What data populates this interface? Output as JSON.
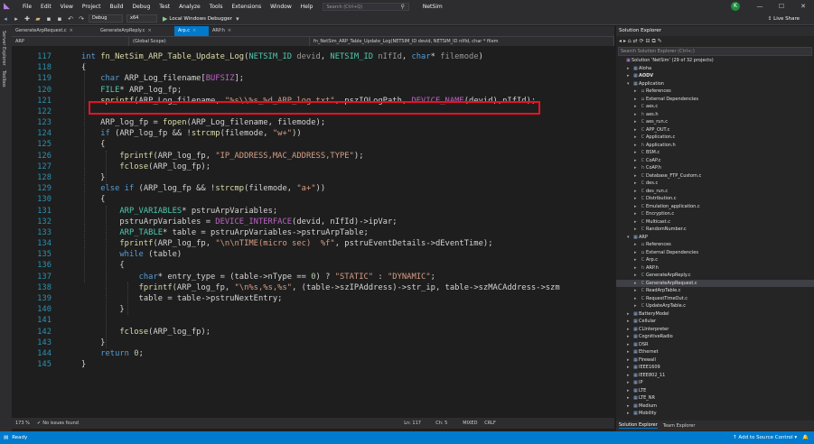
{
  "menubar": {
    "items": [
      "File",
      "Edit",
      "View",
      "Project",
      "Build",
      "Debug",
      "Test",
      "Analyze",
      "Tools",
      "Extensions",
      "Window",
      "Help"
    ],
    "search_placeholder": "Search (Ctrl+Q)",
    "app_title": "NetSim",
    "avatar_letter": "K"
  },
  "toolbar": {
    "config": "Debug",
    "platform": "x64",
    "run_label": "Local Windows Debugger",
    "live_share": "Live Share"
  },
  "left_strip": {
    "server_explorer": "Server Explorer",
    "toolbox": "Toolbox"
  },
  "tabs": [
    {
      "label": "GenerateArpRequest.c",
      "close": "×"
    },
    {
      "label": "GenerateArpReply.c",
      "close": "×"
    },
    {
      "label": "Arp.c",
      "close": "×"
    },
    {
      "label": "ARP.h",
      "close": "×"
    }
  ],
  "scope": {
    "project": "ARP",
    "scope": "(Global Scope)",
    "function": "fn_NetSim_ARP_Table_Update_Log(NETSIM_ID devid, NETSIM_ID nIfId, char * filem"
  },
  "code": {
    "line_numbers": [
      "117",
      "118",
      "119",
      "120",
      "121",
      "122",
      "123",
      "124",
      "125",
      "126",
      "127",
      "128",
      "129",
      "130",
      "131",
      "132",
      "133",
      "134",
      "135",
      "136",
      "137",
      "138",
      "139",
      "140",
      "141",
      "142",
      "143",
      "144",
      "145"
    ],
    "lines": [
      [
        [
          "kw",
          "int "
        ],
        [
          "fn",
          "fn_NetSim_ARP_Table_Update_Log"
        ],
        [
          "",
          "("
        ],
        [
          "ty",
          "NETSIM_ID"
        ],
        [
          "pm",
          " devid"
        ],
        [
          "",
          ", "
        ],
        [
          "ty",
          "NETSIM_ID"
        ],
        [
          "pm",
          " nIfId"
        ],
        [
          "",
          ", "
        ],
        [
          "kw",
          "char"
        ],
        [
          "",
          "* "
        ],
        [
          "pm",
          "filemode"
        ],
        [
          "",
          ")"
        ]
      ],
      [
        [
          "",
          "{"
        ]
      ],
      [
        [
          "",
          "    "
        ],
        [
          "kw",
          "char"
        ],
        [
          "",
          ""
        ],
        [
          "",
          " ARP_Log_filename["
        ],
        [
          "mc",
          "BUFSIZ"
        ],
        [
          "",
          "];"
        ]
      ],
      [
        [
          "",
          "    "
        ],
        [
          "ty",
          "FILE"
        ],
        [
          "",
          "* ARP_log_fp;"
        ]
      ],
      [
        [
          "",
          "    "
        ],
        [
          "fn",
          "sprintf"
        ],
        [
          "",
          "(ARP_Log_filename, "
        ],
        [
          "st",
          "\"%s\\\\%s_%d_ARP_log.txt\""
        ],
        [
          "",
          ", pszIOLogPath, "
        ],
        [
          "mc",
          "DEVICE_NAME"
        ],
        [
          "",
          "(devid),nIfId);"
        ]
      ],
      [
        [
          "",
          ""
        ]
      ],
      [
        [
          "",
          "    ARP_log_fp = "
        ],
        [
          "fn",
          "fopen"
        ],
        [
          "",
          "(ARP_Log_filename, filemode);"
        ]
      ],
      [
        [
          "",
          "    "
        ],
        [
          "kw",
          "if"
        ],
        [
          "",
          " (ARP_log_fp && !"
        ],
        [
          "fn",
          "strcmp"
        ],
        [
          "",
          "(filemode, "
        ],
        [
          "st",
          "\"w+\""
        ],
        [
          "",
          "))"
        ]
      ],
      [
        [
          "",
          "    {"
        ]
      ],
      [
        [
          "",
          "        "
        ],
        [
          "fn",
          "fprintf"
        ],
        [
          "",
          "(ARP_log_fp, "
        ],
        [
          "st",
          "\"IP_ADDRESS,MAC_ADDRESS,TYPE\""
        ],
        [
          "",
          ");"
        ]
      ],
      [
        [
          "",
          "        "
        ],
        [
          "fn",
          "fclose"
        ],
        [
          "",
          "(ARP_log_fp);"
        ]
      ],
      [
        [
          "",
          "    }"
        ]
      ],
      [
        [
          "",
          "    "
        ],
        [
          "kw",
          "else if"
        ],
        [
          "",
          " (ARP_log_fp && !"
        ],
        [
          "fn",
          "strcmp"
        ],
        [
          "",
          "(filemode, "
        ],
        [
          "st",
          "\"a+\""
        ],
        [
          "",
          "))"
        ]
      ],
      [
        [
          "",
          "    {"
        ]
      ],
      [
        [
          "",
          "        "
        ],
        [
          "ty",
          "ARP_VARIABLES"
        ],
        [
          "",
          "* pstruArpVariables;"
        ]
      ],
      [
        [
          "",
          "        pstruArpVariables = "
        ],
        [
          "mc",
          "DEVICE_INTERFACE"
        ],
        [
          "",
          "(devid, nIfId)->ipVar;"
        ]
      ],
      [
        [
          "",
          "        "
        ],
        [
          "ty",
          "ARP_TABLE"
        ],
        [
          "",
          "* table = pstruArpVariables->pstruArpTable;"
        ]
      ],
      [
        [
          "",
          "        "
        ],
        [
          "fn",
          "fprintf"
        ],
        [
          "",
          "(ARP_log_fp, "
        ],
        [
          "st",
          "\"\\n\\nTIME(micro sec)  %f\""
        ],
        [
          "",
          ", pstruEventDetails->dEventTime);"
        ]
      ],
      [
        [
          "",
          "        "
        ],
        [
          "kw",
          "while"
        ],
        [
          "",
          " (table)"
        ]
      ],
      [
        [
          "",
          "        {"
        ]
      ],
      [
        [
          "",
          "            "
        ],
        [
          "kw",
          "char"
        ],
        [
          "",
          "* entry_type = (table->nType == "
        ],
        [
          "nm",
          "0"
        ],
        [
          "",
          ") ? "
        ],
        [
          "st",
          "\"STATIC\""
        ],
        [
          "",
          " : "
        ],
        [
          "st",
          "\"DYNAMIC\""
        ],
        [
          "",
          ";"
        ]
      ],
      [
        [
          "",
          "            "
        ],
        [
          "fn",
          "fprintf"
        ],
        [
          "",
          "(ARP_log_fp, "
        ],
        [
          "st",
          "\"\\n%s,%s,%s\""
        ],
        [
          "",
          ", (table->szIPAddress)->str_ip, table->szMACAddress->szm"
        ]
      ],
      [
        [
          "",
          "            table = table->pstruNextEntry;"
        ]
      ],
      [
        [
          "",
          "        }"
        ]
      ],
      [
        [
          "",
          ""
        ]
      ],
      [
        [
          "",
          "        "
        ],
        [
          "fn",
          "fclose"
        ],
        [
          "",
          "(ARP_log_fp);"
        ]
      ],
      [
        [
          "",
          "    }"
        ]
      ],
      [
        [
          "",
          "    "
        ],
        [
          "kw",
          "return"
        ],
        [
          "",
          " "
        ],
        [
          "nm",
          "0"
        ],
        [
          "",
          ";"
        ]
      ],
      [
        [
          "",
          "}"
        ]
      ]
    ]
  },
  "editor_status": {
    "zoom": "173 %",
    "issues": "No issues found",
    "position": "Ln: 117",
    "col": "Ch: 5",
    "mixed": "MIXED",
    "crlf": "CRLF"
  },
  "solution_explorer": {
    "title": "Solution Explorer",
    "search_placeholder": "Search Solution Explorer (Ctrl+;)",
    "tree": [
      {
        "label": "Solution 'NetSim' (29 of 32 projects)",
        "d": 0,
        "i": "▣",
        "c": "#b180d7",
        "a": ""
      },
      {
        "label": "Aloha",
        "d": 1,
        "i": "▦",
        "c": "#8fb0d9",
        "a": "▸"
      },
      {
        "label": "AODV",
        "d": 1,
        "i": "▦",
        "c": "#8fb0d9",
        "a": "▸"
      },
      {
        "label": "Application",
        "d": 1,
        "i": "▦",
        "c": "#8fb0d9",
        "a": "▾"
      },
      {
        "label": "References",
        "d": 2,
        "i": "▫",
        "c": "#ccc",
        "a": "▸"
      },
      {
        "label": "External Dependencies",
        "d": 2,
        "i": "▫",
        "c": "#ccc",
        "a": "▸"
      },
      {
        "label": "aes.c",
        "d": 2,
        "i": "C",
        "c": "#9b9b9b",
        "a": "▸"
      },
      {
        "label": "aes.h",
        "d": 2,
        "i": "h",
        "c": "#9b9b9b",
        "a": "▸"
      },
      {
        "label": "aes_run.c",
        "d": 2,
        "i": "C",
        "c": "#9b9b9b",
        "a": "▸"
      },
      {
        "label": "APP_OUT.c",
        "d": 2,
        "i": "C",
        "c": "#9b9b9b",
        "a": "▸"
      },
      {
        "label": "Application.c",
        "d": 2,
        "i": "C",
        "c": "#9b9b9b",
        "a": "▸"
      },
      {
        "label": "Application.h",
        "d": 2,
        "i": "h",
        "c": "#9b9b9b",
        "a": "▸"
      },
      {
        "label": "BSM.c",
        "d": 2,
        "i": "C",
        "c": "#9b9b9b",
        "a": "▸"
      },
      {
        "label": "CoAP.c",
        "d": 2,
        "i": "C",
        "c": "#9b9b9b",
        "a": "▸"
      },
      {
        "label": "CoAP.h",
        "d": 2,
        "i": "h",
        "c": "#9b9b9b",
        "a": "▸"
      },
      {
        "label": "Database_FTP_Custom.c",
        "d": 2,
        "i": "C",
        "c": "#9b9b9b",
        "a": "▸"
      },
      {
        "label": "des.c",
        "d": 2,
        "i": "C",
        "c": "#9b9b9b",
        "a": "▸"
      },
      {
        "label": "des_run.c",
        "d": 2,
        "i": "C",
        "c": "#9b9b9b",
        "a": "▸"
      },
      {
        "label": "Distribution.c",
        "d": 2,
        "i": "C",
        "c": "#9b9b9b",
        "a": "▸"
      },
      {
        "label": "Emulation_application.c",
        "d": 2,
        "i": "C",
        "c": "#9b9b9b",
        "a": "▸"
      },
      {
        "label": "Encryption.c",
        "d": 2,
        "i": "C",
        "c": "#9b9b9b",
        "a": "▸"
      },
      {
        "label": "Multicast.c",
        "d": 2,
        "i": "C",
        "c": "#9b9b9b",
        "a": "▸"
      },
      {
        "label": "RandomNumber.c",
        "d": 2,
        "i": "C",
        "c": "#9b9b9b",
        "a": "▸"
      },
      {
        "label": "ARP",
        "d": 1,
        "i": "▦",
        "c": "#8fb0d9",
        "a": "▾"
      },
      {
        "label": "References",
        "d": 2,
        "i": "▫",
        "c": "#ccc",
        "a": "▸"
      },
      {
        "label": "External Dependencies",
        "d": 2,
        "i": "▫",
        "c": "#ccc",
        "a": "▸"
      },
      {
        "label": "Arp.c",
        "d": 2,
        "i": "C",
        "c": "#9b9b9b",
        "a": "▸"
      },
      {
        "label": "ARP.h",
        "d": 2,
        "i": "h",
        "c": "#9b9b9b",
        "a": "▸"
      },
      {
        "label": "GenerateArpReply.c",
        "d": 2,
        "i": "C",
        "c": "#9b9b9b",
        "a": "▸"
      },
      {
        "label": "GenerateArpRequest.c",
        "d": 2,
        "i": "C",
        "c": "#9b9b9b",
        "a": "▸",
        "sel": true
      },
      {
        "label": "ReadArpTable.c",
        "d": 2,
        "i": "C",
        "c": "#9b9b9b",
        "a": "▸"
      },
      {
        "label": "RequestTimeOut.c",
        "d": 2,
        "i": "C",
        "c": "#9b9b9b",
        "a": "▸"
      },
      {
        "label": "UpdateArpTable.c",
        "d": 2,
        "i": "C",
        "c": "#9b9b9b",
        "a": "▸"
      },
      {
        "label": "BatteryModel",
        "d": 1,
        "i": "▦",
        "c": "#8fb0d9",
        "a": "▸"
      },
      {
        "label": "Cellular",
        "d": 1,
        "i": "▦",
        "c": "#8fb0d9",
        "a": "▸"
      },
      {
        "label": "CLInterpreter",
        "d": 1,
        "i": "▦",
        "c": "#8fb0d9",
        "a": "▸"
      },
      {
        "label": "CognitiveRadio",
        "d": 1,
        "i": "▦",
        "c": "#8fb0d9",
        "a": "▸"
      },
      {
        "label": "DSR",
        "d": 1,
        "i": "▦",
        "c": "#8fb0d9",
        "a": "▸"
      },
      {
        "label": "Ethernet",
        "d": 1,
        "i": "▦",
        "c": "#8fb0d9",
        "a": "▸"
      },
      {
        "label": "Firewall",
        "d": 1,
        "i": "▦",
        "c": "#8fb0d9",
        "a": "▸"
      },
      {
        "label": "IEEE1609",
        "d": 1,
        "i": "▦",
        "c": "#8fb0d9",
        "a": "▸"
      },
      {
        "label": "IEEE802_11",
        "d": 1,
        "i": "▦",
        "c": "#8fb0d9",
        "a": "▸"
      },
      {
        "label": "IP",
        "d": 1,
        "i": "▦",
        "c": "#8fb0d9",
        "a": "▸"
      },
      {
        "label": "LTE",
        "d": 1,
        "i": "▦",
        "c": "#8fb0d9",
        "a": "▸"
      },
      {
        "label": "LTE_NR",
        "d": 1,
        "i": "▦",
        "c": "#8fb0d9",
        "a": "▸"
      },
      {
        "label": "Medium",
        "d": 1,
        "i": "▦",
        "c": "#8fb0d9",
        "a": "▸"
      },
      {
        "label": "Mobility",
        "d": 1,
        "i": "▦",
        "c": "#8fb0d9",
        "a": "▸"
      }
    ],
    "bottom_tabs": [
      "Solution Explorer",
      "Team Explorer"
    ]
  },
  "statusbar": {
    "ready": "Ready",
    "source_control": "↑ Add to Source Control ▾"
  }
}
